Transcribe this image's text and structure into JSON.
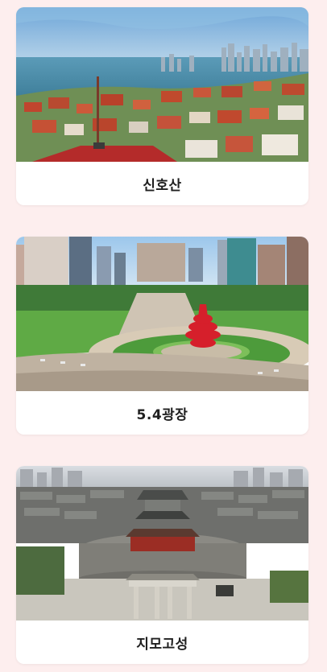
{
  "attractions": [
    {
      "name": "신호산",
      "image": "coastal-city-rooftops-photo"
    },
    {
      "name": "5.4광장",
      "image": "plaza-red-sculpture-photo"
    },
    {
      "name": "지모고성",
      "image": "ancient-city-gate-photo"
    }
  ],
  "colors": {
    "background": "#fdeeee",
    "card": "#ffffff",
    "caption_text": "#1f1f1f"
  }
}
